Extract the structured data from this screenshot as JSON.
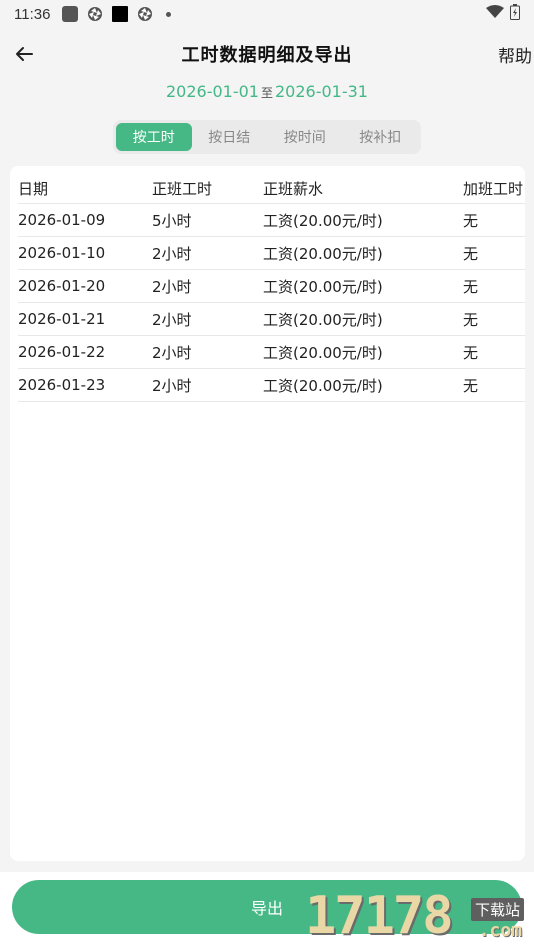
{
  "status_bar": {
    "time": "11:36"
  },
  "header": {
    "title": "工时数据明细及导出",
    "help": "帮助"
  },
  "date_range": {
    "start": "2026-01-01",
    "separator": "至",
    "end": "2026-01-31"
  },
  "tabs": [
    {
      "label": "按工时",
      "active": true
    },
    {
      "label": "按日结",
      "active": false
    },
    {
      "label": "按时间",
      "active": false
    },
    {
      "label": "按补扣",
      "active": false
    }
  ],
  "table": {
    "headers": [
      "日期",
      "正班工时",
      "正班薪水",
      "加班工时"
    ],
    "rows": [
      [
        "2026-01-09",
        "5小时",
        "工资(20.00元/时)",
        "无"
      ],
      [
        "2026-01-10",
        "2小时",
        "工资(20.00元/时)",
        "无"
      ],
      [
        "2026-01-20",
        "2小时",
        "工资(20.00元/时)",
        "无"
      ],
      [
        "2026-01-21",
        "2小时",
        "工资(20.00元/时)",
        "无"
      ],
      [
        "2026-01-22",
        "2小时",
        "工资(20.00元/时)",
        "无"
      ],
      [
        "2026-01-23",
        "2小时",
        "工资(20.00元/时)",
        "无"
      ]
    ]
  },
  "export": {
    "label": "导出"
  },
  "watermark": {
    "number": "17178",
    "tag": "下载站",
    "suffix": ".com"
  },
  "colors": {
    "accent": "#45b886",
    "date_text": "#43b886"
  }
}
